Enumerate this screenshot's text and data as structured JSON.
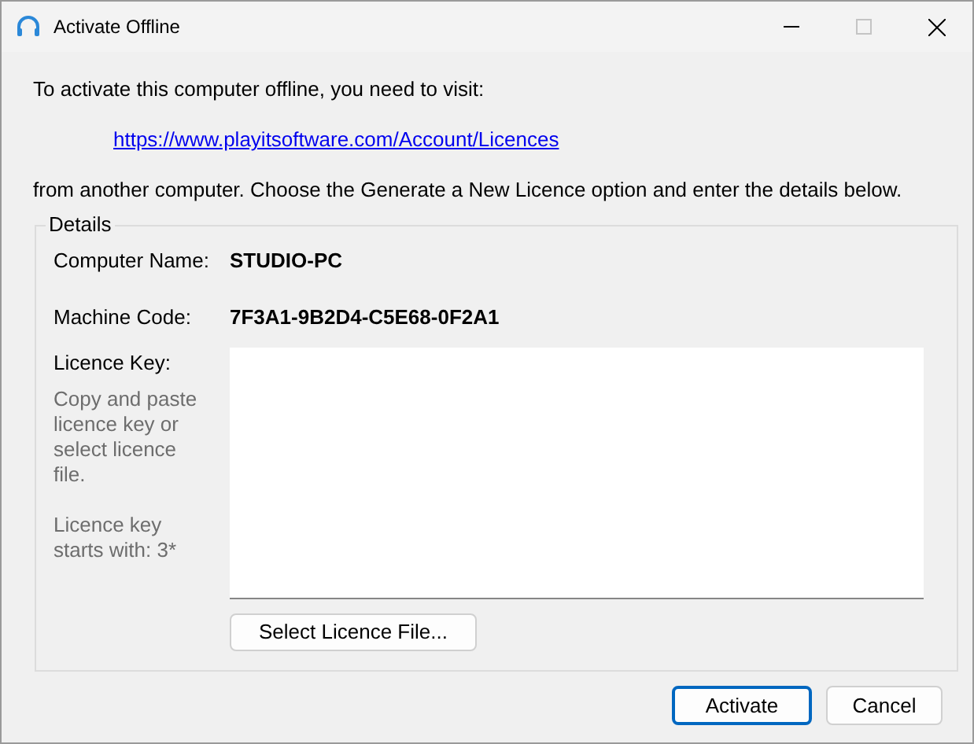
{
  "window": {
    "title": "Activate Offline"
  },
  "intro": "To activate this computer offline, you need to visit:",
  "link": "https://www.playitsoftware.com/Account/Licences",
  "instructions": "from another computer. Choose the Generate a New Licence option and enter the details below.",
  "details": {
    "legend": "Details",
    "fields": [
      {
        "label": "Computer Name:",
        "value": "STUDIO-PC"
      },
      {
        "label": "Machine Code:",
        "value": "7F3A1-9B2D4-C5E68-0F2A1"
      }
    ],
    "licence_key": {
      "label": "Licence Key:",
      "hint": "Copy and paste licence key or select licence file.",
      "prefix_hint": "Licence key starts with: 3*"
    },
    "select_button": "Select Licence File..."
  },
  "buttons": [
    {
      "label": "Activate",
      "default": true
    },
    {
      "label": "Cancel",
      "default": false
    }
  ]
}
